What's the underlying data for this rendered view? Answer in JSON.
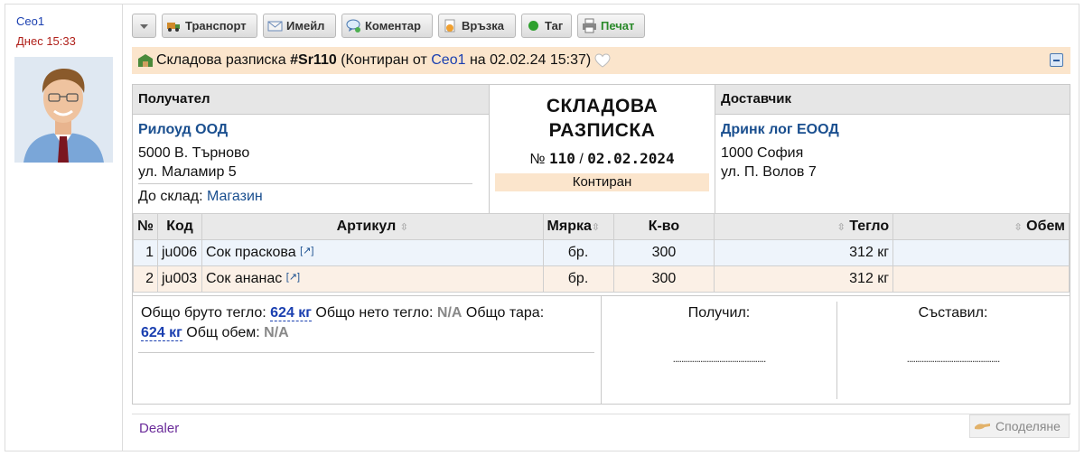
{
  "author": {
    "name": "Ceo1",
    "date": "Днес 15:33"
  },
  "toolbar": {
    "buttons": [
      "Транспорт",
      "Имейл",
      "Коментар",
      "Връзка",
      "Таг",
      "Печат"
    ]
  },
  "header": {
    "title_prefix": "Складова разписка",
    "doc_code": "#Sr110",
    "status_open": "(Контиран от",
    "user": "Ceo1",
    "date_text": "на 02.02.24 15:37)"
  },
  "recipient": {
    "heading": "Получател",
    "company": "Рилоуд ООД",
    "address1": "5000 В. Търново",
    "address2": "ул. Маламир 5",
    "warehouse_label": "До склад:",
    "warehouse": "Магазин"
  },
  "document": {
    "title_line1": "СКЛАДОВА",
    "title_line2": "РАЗПИСКА",
    "number_prefix": "№",
    "number": "110",
    "separator": "/",
    "date": "02.02.2024",
    "state": "Контиран"
  },
  "supplier": {
    "heading": "Доставчик",
    "company": "Дринк лог ЕООД",
    "address1": "1000 София",
    "address2": "ул. П. Волов 7"
  },
  "table": {
    "headers": [
      "№",
      "Код",
      "Артикул",
      "Мярка",
      "К-во",
      "Тегло",
      "Обем"
    ],
    "rows": [
      {
        "no": "1",
        "code": "ju006",
        "name": "Сок праскова",
        "unit": "бр.",
        "qty": "300",
        "weight": "312 кг",
        "volume": ""
      },
      {
        "no": "2",
        "code": "ju003",
        "name": "Сок ананас",
        "unit": "бр.",
        "qty": "300",
        "weight": "312 кг",
        "volume": ""
      }
    ]
  },
  "summary": {
    "gross_label": "Общо бруто тегло:",
    "gross_value": "624 кг",
    "net_label": "Общо нето тегло:",
    "net_value": "N/A",
    "tare_label": "Общо тара:",
    "tare_value": "624 кг",
    "volume_label": "Общ обем:",
    "volume_value": "N/A"
  },
  "signatures": {
    "received": "Получил:",
    "composed": "Съставил:",
    "dots": "............................................"
  },
  "footer": {
    "dealer": "Dealer",
    "share": "Споделяне"
  },
  "colors": {
    "accent_link": "#1a3fb0",
    "header_bg": "#fbe5cc",
    "date_red": "#b0201a"
  }
}
